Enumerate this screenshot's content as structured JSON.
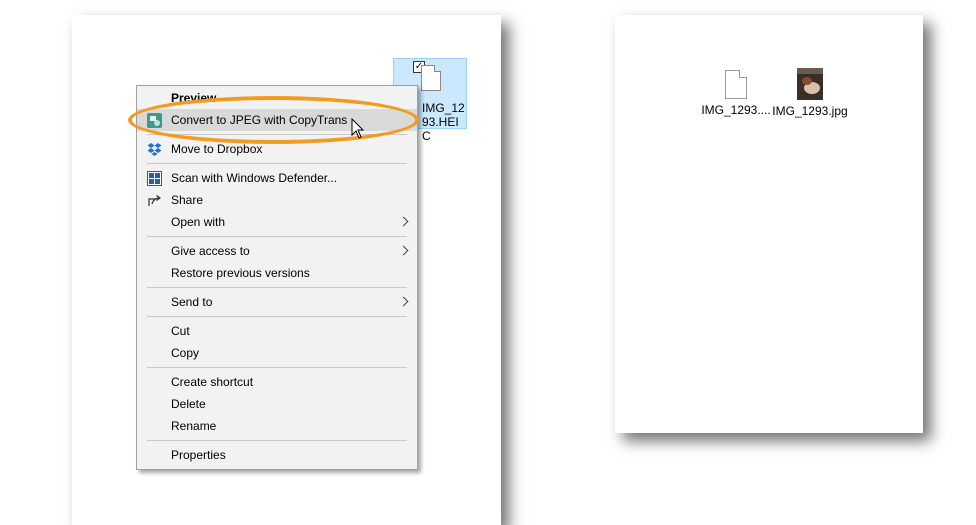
{
  "left_window": {
    "selected_file": {
      "name": "IMG_1293.HEIC",
      "checked": true
    }
  },
  "context_menu": {
    "items": [
      {
        "label": "Preview",
        "bold": true
      },
      {
        "label": "Convert to JPEG with CopyTrans",
        "icon": "copytrans-icon",
        "highlighted": true
      },
      {
        "label": "Move to Dropbox",
        "icon": "dropbox-icon"
      },
      {
        "label": "Scan with Windows Defender...",
        "icon": "windows-defender-icon"
      },
      {
        "label": "Share",
        "icon": "share-icon"
      },
      {
        "label": "Open with",
        "submenu": true
      },
      {
        "label": "Give access to",
        "submenu": true
      },
      {
        "label": "Restore previous versions"
      },
      {
        "label": "Send to",
        "submenu": true
      },
      {
        "label": "Cut"
      },
      {
        "label": "Copy"
      },
      {
        "label": "Create shortcut"
      },
      {
        "label": "Delete"
      },
      {
        "label": "Rename"
      },
      {
        "label": "Properties"
      }
    ]
  },
  "right_window": {
    "files": [
      {
        "name": "IMG_1293....",
        "icon": "blank-file-icon"
      },
      {
        "name": "IMG_1293.jpg",
        "icon": "image-thumbnail"
      }
    ]
  },
  "colors": {
    "highlight_ring": "#f39a20",
    "selection_bg": "#cce8ff",
    "menu_bg": "#f2f2f2"
  }
}
